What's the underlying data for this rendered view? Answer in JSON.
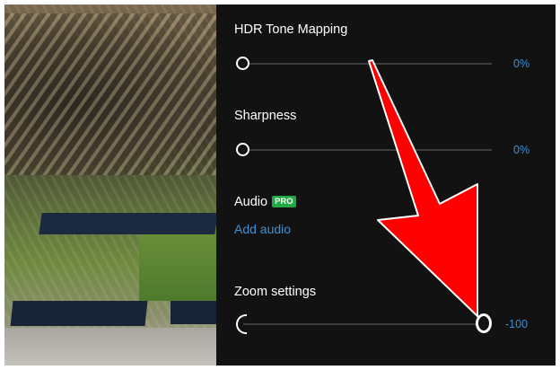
{
  "settings": {
    "hdr": {
      "label": "HDR Tone Mapping",
      "value": "0%",
      "level": 0
    },
    "sharpness": {
      "label": "Sharpness",
      "value": "0%",
      "level": 0
    },
    "audio": {
      "label": "Audio",
      "badge": "PRO",
      "link": "Add audio"
    },
    "zoom": {
      "label": "Zoom settings",
      "value": "-100"
    }
  },
  "colors": {
    "panel_bg": "#121212",
    "accent_value": "#3f8fd8",
    "pro_badge": "#22a845",
    "annotation_arrow": "#ff0000"
  }
}
